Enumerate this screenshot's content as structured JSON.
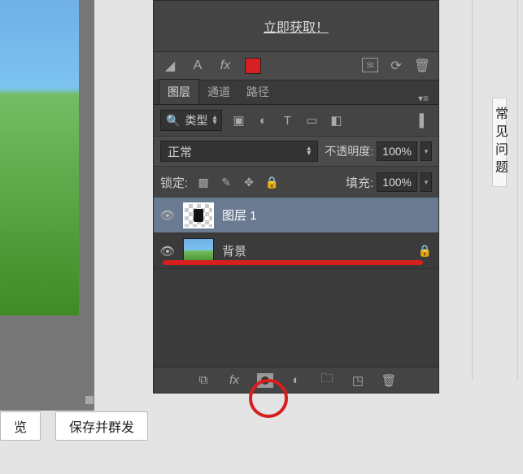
{
  "banner": {
    "link_text": "立即获取！"
  },
  "color_toolbar": {
    "swatch_color": "#d42020"
  },
  "tabs": {
    "layers": "图层",
    "channels": "通道",
    "paths": "路径"
  },
  "filter": {
    "kind_label": "类型"
  },
  "blend": {
    "mode": "正常",
    "opacity_label": "不透明度:",
    "opacity_value": "100%"
  },
  "lock": {
    "label": "锁定:",
    "fill_label": "填充:",
    "fill_value": "100%"
  },
  "layers": [
    {
      "name": "图层 1",
      "selected": true,
      "locked": false,
      "thumb": "checker"
    },
    {
      "name": "背景",
      "selected": false,
      "locked": true,
      "thumb": "landscape"
    }
  ],
  "side_tab": {
    "label": "常见问题"
  },
  "bottom_buttons": {
    "preview": "览",
    "save_broadcast": "保存并群发"
  }
}
